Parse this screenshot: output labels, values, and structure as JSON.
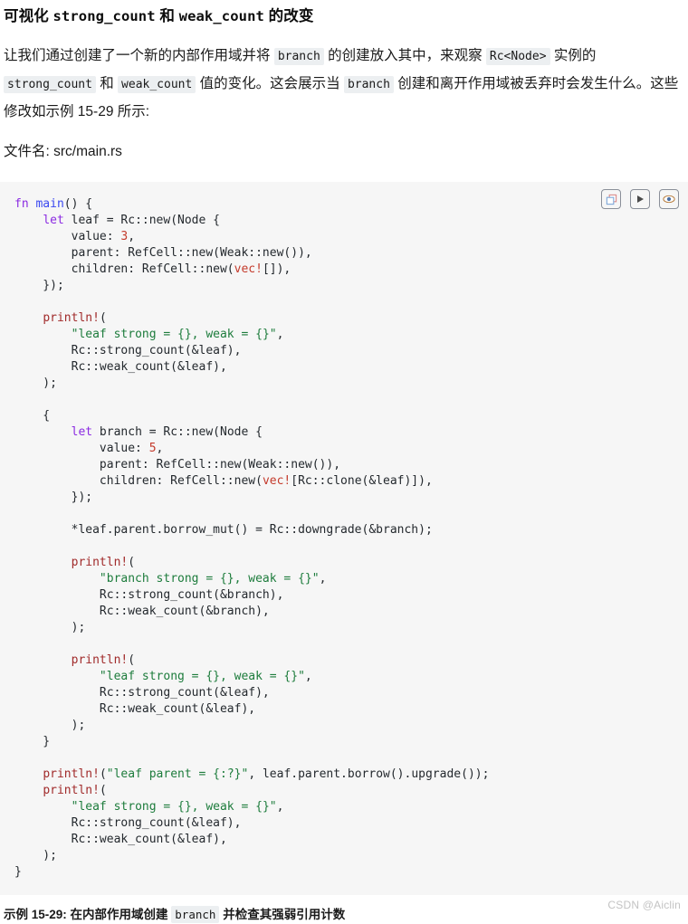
{
  "heading": {
    "prefix": "可视化 ",
    "code1": "strong_count",
    "mid": " 和 ",
    "code2": "weak_count",
    "suffix": " 的改变"
  },
  "paragraph1": {
    "part1": "让我们通过创建了一个新的内部作用域并将 ",
    "code1": "branch",
    "part2": " 的创建放入其中，来观察 ",
    "code2": "Rc<Node>",
    "part3": " 实例的 ",
    "code3": "strong_count",
    "part4": " 和 ",
    "code4": "weak_count",
    "part5": " 值的变化。这会展示当 ",
    "code5": "branch",
    "part6": " 创建和离开作用域被丢弃时会发生什么。这些修改如示例 15-29 所示:"
  },
  "filename": {
    "label": "文件名:",
    "value": "src/main.rs"
  },
  "toolbar": {
    "copy_label": "copy-code",
    "run_label": "run-code",
    "preview_label": "preview-code",
    "icon_border_color": "#8a8f99"
  },
  "code": {
    "language": "rust",
    "background": "#f6f6f6",
    "lines": [
      "fn main() {",
      "    let leaf = Rc::new(Node {",
      "        value: 3,",
      "        parent: RefCell::new(Weak::new()),",
      "        children: RefCell::new(vec![]),",
      "    });",
      "",
      "    println!(",
      "        \"leaf strong = {}, weak = {}\",",
      "        Rc::strong_count(&leaf),",
      "        Rc::weak_count(&leaf),",
      "    );",
      "",
      "    {",
      "        let branch = Rc::new(Node {",
      "            value: 5,",
      "            parent: RefCell::new(Weak::new()),",
      "            children: RefCell::new(vec![Rc::clone(&leaf)]),",
      "        });",
      "",
      "        *leaf.parent.borrow_mut() = Rc::downgrade(&branch);",
      "",
      "        println!(",
      "            \"branch strong = {}, weak = {}\",",
      "            Rc::strong_count(&branch),",
      "            Rc::weak_count(&branch),",
      "        );",
      "",
      "        println!(",
      "            \"leaf strong = {}, weak = {}\",",
      "            Rc::strong_count(&leaf),",
      "            Rc::weak_count(&leaf),",
      "        );",
      "    }",
      "",
      "    println!(\"leaf parent = {:?}\", leaf.parent.borrow().upgrade());",
      "    println!(",
      "        \"leaf strong = {}, weak = {}\",",
      "        Rc::strong_count(&leaf),",
      "        Rc::weak_count(&leaf),",
      "    );",
      "}"
    ]
  },
  "caption": {
    "part1": "示例 15-29: 在内部作用域创建 ",
    "code1": "branch",
    "part2": " 并检查其强弱引用计数"
  },
  "watermark": "CSDN @Aiclin"
}
